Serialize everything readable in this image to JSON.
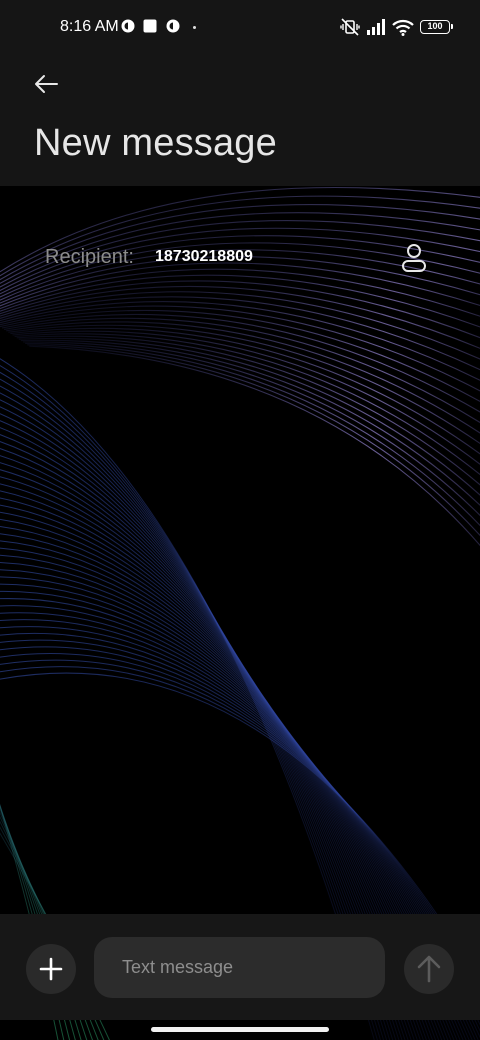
{
  "status_bar": {
    "time": "8:16 AM",
    "battery": "100",
    "icons": [
      "notification-c-icon",
      "notification-square-icon",
      "notification-c-icon",
      "dot-icon",
      "vibrate-mute-icon",
      "signal-icon",
      "wifi-icon",
      "battery-icon"
    ]
  },
  "header": {
    "back_icon": "back-arrow-icon",
    "title": "New message"
  },
  "recipient": {
    "label": "Recipient:",
    "value": "18730218809",
    "contact_icon": "person-icon"
  },
  "compose": {
    "add_icon": "plus-icon",
    "placeholder": "Text message",
    "send_icon": "arrow-up-icon"
  },
  "colors": {
    "header_bg": "#151515",
    "compose_bg": "#171717",
    "input_bg": "#2c2c2c",
    "wallpaper_line_blue": "#5a6fd0",
    "wallpaper_line_purple": "#8f80d8",
    "wallpaper_line_green": "#2e9a6a"
  }
}
